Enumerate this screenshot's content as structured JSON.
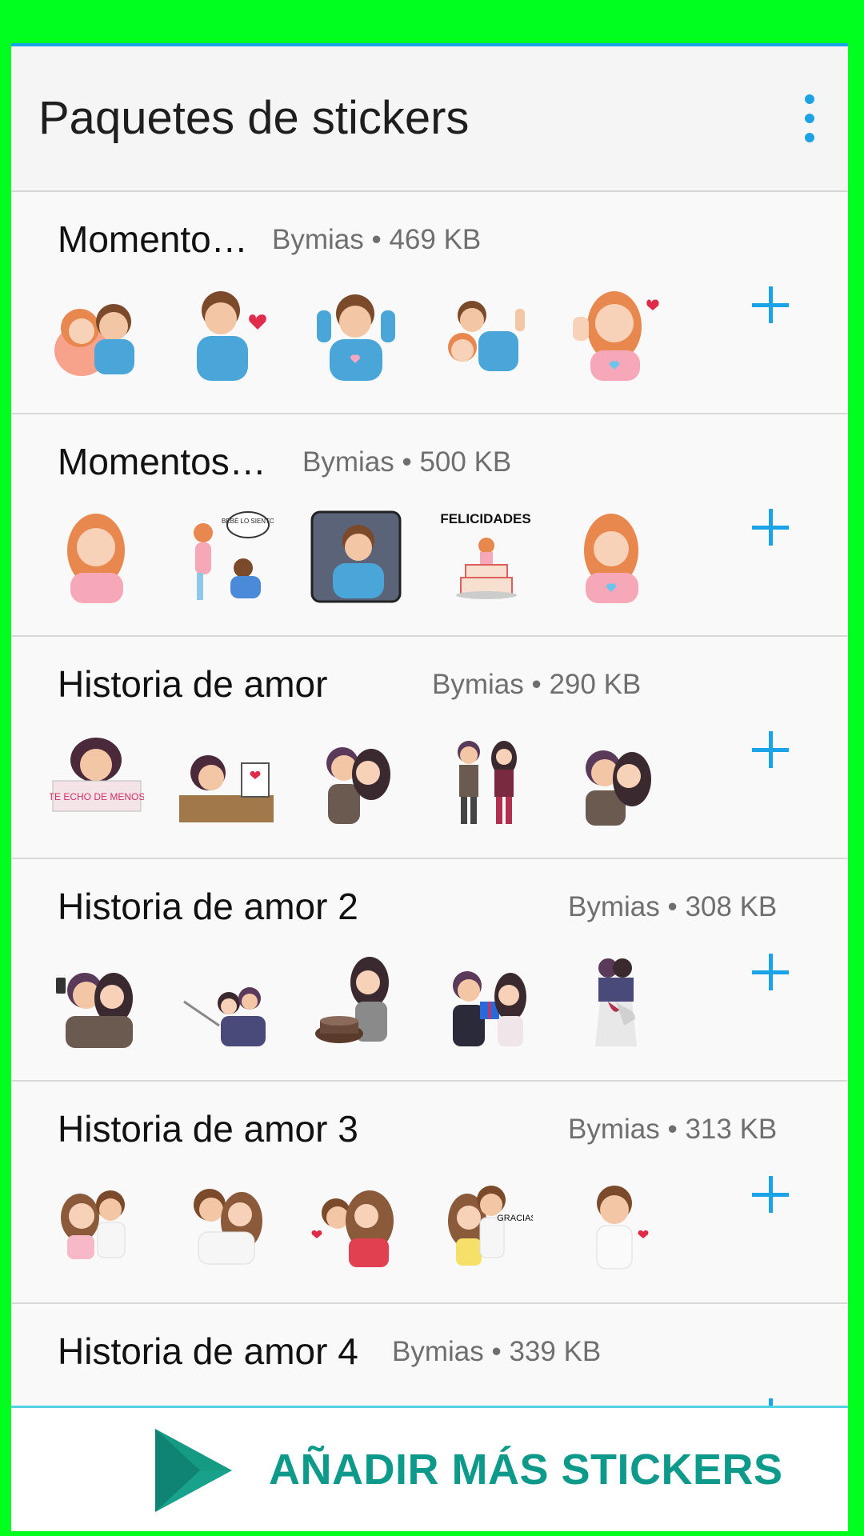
{
  "appbar": {
    "title": "Paquetes de stickers",
    "menu_icon": "more-vert-icon"
  },
  "colors": {
    "accent": "#1aa3e8",
    "frame": "#00ff1e",
    "cta": "#0e9a8a"
  },
  "packs": [
    {
      "name": "Momento…",
      "meta": "Bymias • 469 KB",
      "add_icon": "add-icon"
    },
    {
      "name": "Momentos…",
      "meta": "Bymias • 500 KB",
      "add_icon": "add-icon"
    },
    {
      "name": "Historia de amor",
      "meta": "Bymias • 290 KB",
      "add_icon": "add-icon"
    },
    {
      "name": "Historia de amor 2",
      "meta": "Bymias • 308 KB",
      "add_icon": "add-icon"
    },
    {
      "name": "Historia de amor 3",
      "meta": "Bymias • 313 KB",
      "add_icon": "add-icon"
    },
    {
      "name": "Historia de amor 4",
      "meta": "Bymias • 339 KB",
      "add_icon": "add-icon"
    }
  ],
  "sticker_text": {
    "bebe": "BEBÉ LO SIENTO",
    "felicidades": "FELICIDADES",
    "echo": "TE ECHO DE MENOS",
    "gracias": "GRACIAS"
  },
  "bottom_button": {
    "label": "AÑADIR MÁS STICKERS",
    "icon": "play-store-icon"
  }
}
